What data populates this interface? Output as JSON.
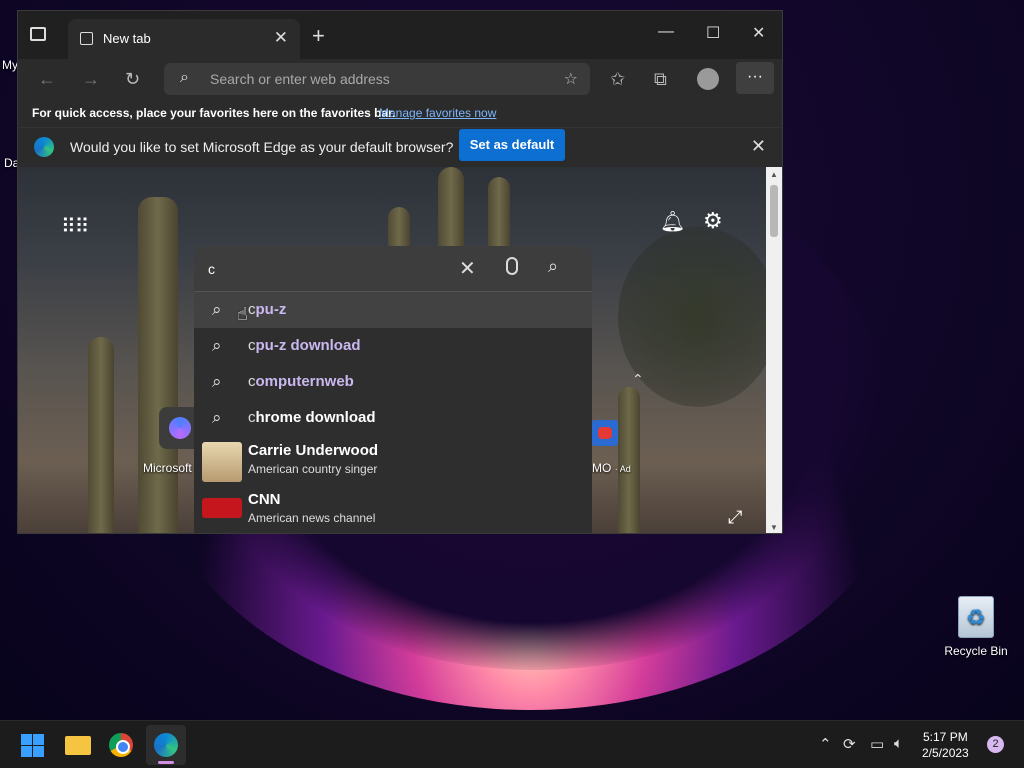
{
  "desktop": {
    "left_labels": [
      "My",
      "Da"
    ],
    "recycle_bin_label": "Recycle Bin"
  },
  "browser": {
    "tab_title": "New tab",
    "address_placeholder": "Search or enter web address",
    "favorites_bar": {
      "text": "For quick access, place your favorites here on the favorites bar.",
      "link": "Manage favorites now"
    },
    "infobar": {
      "message": "Would you like to set Microsoft Edge as your default browser?",
      "button": "Set as default"
    }
  },
  "newtab": {
    "search_query": "c",
    "suggestions": [
      {
        "typed": "c",
        "rest": "pu-z",
        "visited": true
      },
      {
        "typed": "c",
        "rest": "pu-z download",
        "visited": true
      },
      {
        "typed": "c",
        "rest": "omputernweb",
        "visited": true
      },
      {
        "typed": "c",
        "rest": "hrome download",
        "visited": false
      }
    ],
    "entities": [
      {
        "name": "Carrie Underwood",
        "description": "American country singer"
      },
      {
        "name": "CNN",
        "description": "American news channel"
      }
    ],
    "tile_left_label": "Microsoft",
    "tile_right_label": "MO",
    "tile_right_ad": "· Ad"
  },
  "taskbar": {
    "time": "5:17 PM",
    "date": "2/5/2023",
    "notification_count": "2"
  },
  "colors": {
    "accent": "#0d6fd1",
    "link": "#7bb6ff",
    "visited_suggestion": "#c9b8f0"
  }
}
